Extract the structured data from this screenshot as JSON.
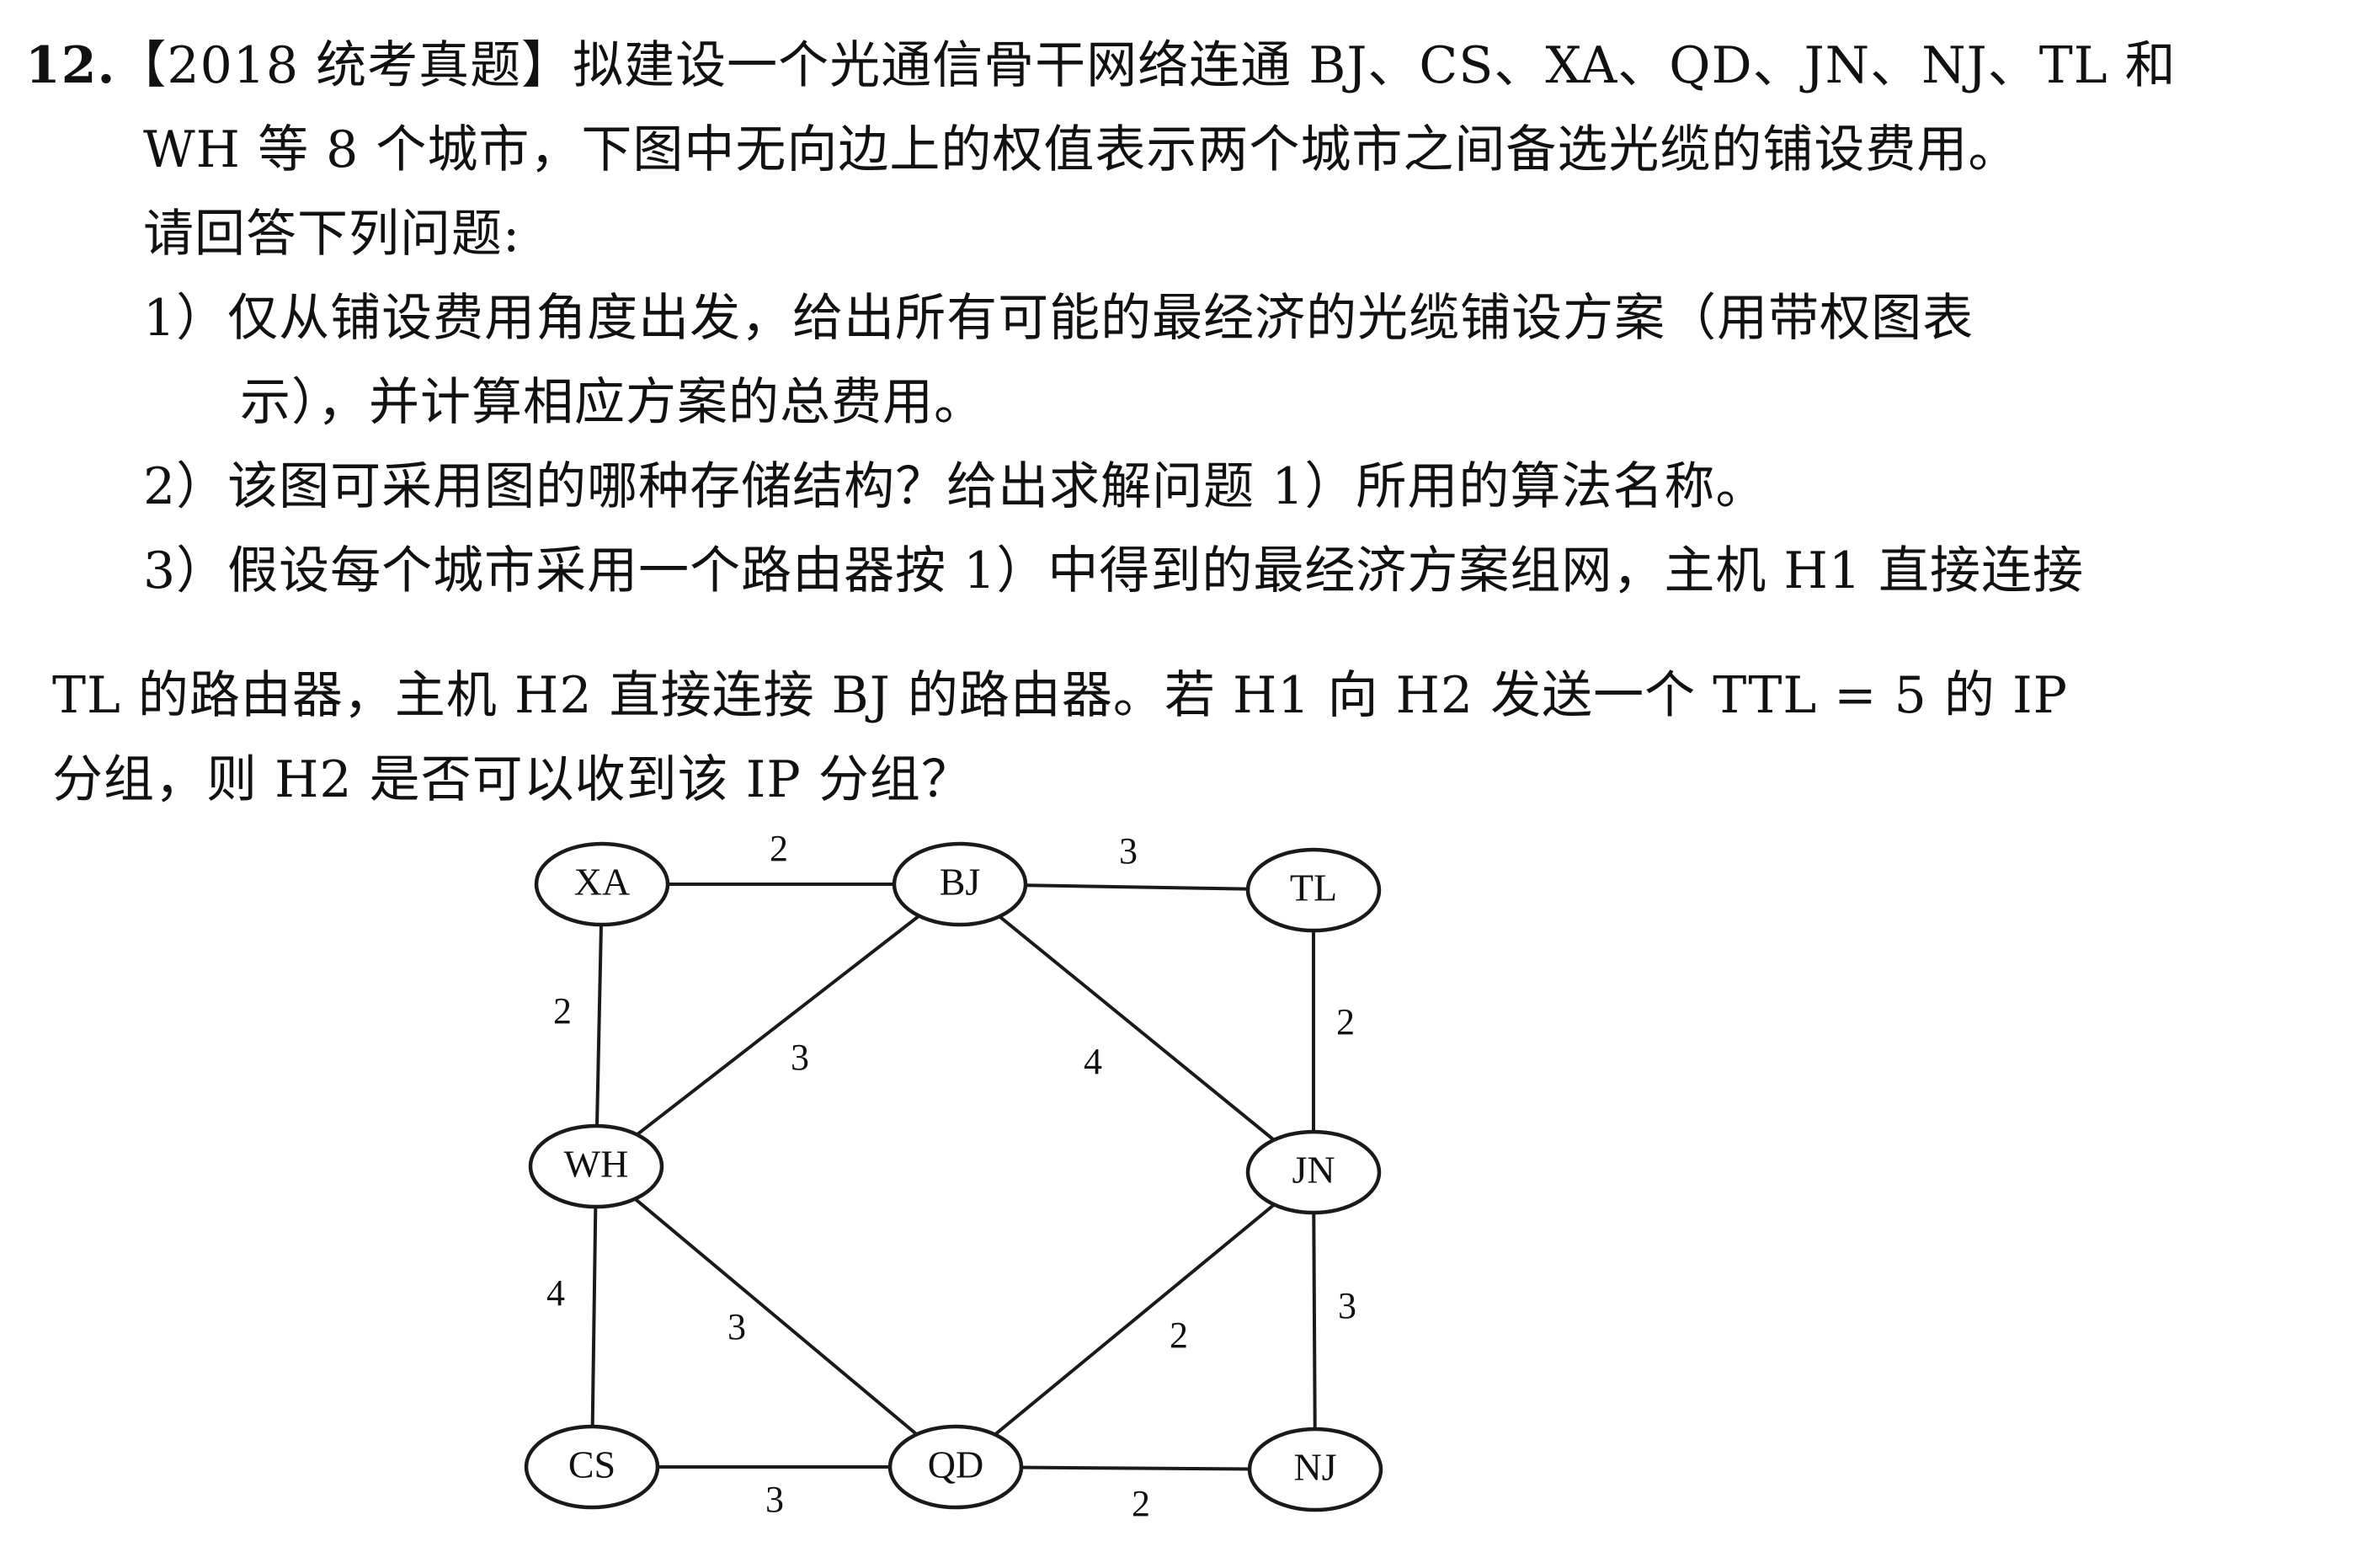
{
  "question": {
    "number": "12.",
    "line1": "【2018 统考真题】拟建设一个光通信骨干网络连通 BJ、CS、XA、QD、JN、NJ、TL 和",
    "line2": "WH 等 8 个城市，下图中无向边上的权值表示两个城市之间备选光缆的铺设费用。",
    "line3": "请回答下列问题:",
    "line4": "1）仅从铺设费用角度出发，给出所有可能的最经济的光缆铺设方案（用带权图表",
    "line5": "示），并计算相应方案的总费用。",
    "line6": "2）该图可采用图的哪种存储结构？给出求解问题 1）所用的算法名称。",
    "line7": "3）假设每个城市采用一个路由器按 1）中得到的最经济方案组网，主机 H1 直接连接",
    "line8": "TL 的路由器，主机 H2 直接连接 BJ 的路由器。若 H1 向 H2 发送一个 TTL = 5 的 IP",
    "line9": "分组，则 H2 是否可以收到该 IP 分组？"
  },
  "graph": {
    "nodes": [
      "XA",
      "BJ",
      "TL",
      "WH",
      "JN",
      "CS",
      "QD",
      "NJ"
    ],
    "edges": [
      {
        "from": "XA",
        "to": "BJ",
        "weight": "2"
      },
      {
        "from": "BJ",
        "to": "TL",
        "weight": "3"
      },
      {
        "from": "XA",
        "to": "WH",
        "weight": "2"
      },
      {
        "from": "BJ",
        "to": "WH",
        "weight": "3"
      },
      {
        "from": "BJ",
        "to": "JN",
        "weight": "4"
      },
      {
        "from": "TL",
        "to": "JN",
        "weight": "2"
      },
      {
        "from": "WH",
        "to": "CS",
        "weight": "4"
      },
      {
        "from": "WH",
        "to": "QD",
        "weight": "3"
      },
      {
        "from": "JN",
        "to": "QD",
        "weight": "2"
      },
      {
        "from": "JN",
        "to": "NJ",
        "weight": "3"
      },
      {
        "from": "CS",
        "to": "QD",
        "weight": "3"
      },
      {
        "from": "QD",
        "to": "NJ",
        "weight": "2"
      }
    ]
  }
}
